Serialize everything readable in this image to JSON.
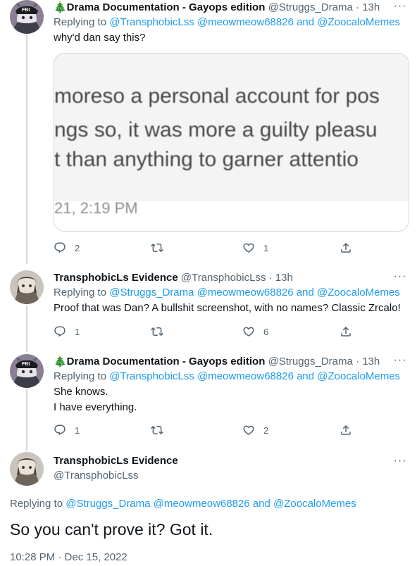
{
  "tweets": [
    {
      "name": "🎄Drama Documentation - Gayops edition",
      "handle": "@Struggs_Drama",
      "time": "13h",
      "replying_prefix": "Replying to",
      "replying_to": "@TransphobicLss @meowmeow68826",
      "replying_and": "and",
      "replying_last": "@ZoocaloMemes",
      "text_lines": [
        "why'd dan say this?"
      ],
      "image": {
        "lines": [
          "moreso a personal account for pos",
          "ngs so, it was more a guilty pleasu",
          "t than anything to garner attentio"
        ],
        "time": "21, 2:19 PM"
      },
      "counts": {
        "reply": "2",
        "retweet": "",
        "like": "1"
      }
    },
    {
      "name": "TransphobicLs Evidence",
      "handle": "@TransphobicLss",
      "time": "13h",
      "replying_prefix": "Replying to",
      "replying_to": "@Struggs_Drama @meowmeow68826",
      "replying_and": "and",
      "replying_last": "@ZoocaloMemes",
      "text_lines": [
        "Proof that was Dan? A bullshit screenshot, with no names? Classic Zrcalo!"
      ],
      "counts": {
        "reply": "1",
        "retweet": "",
        "like": "6"
      }
    },
    {
      "name": "🎄Drama Documentation - Gayops edition",
      "handle": "@Struggs_Drama",
      "time": "13h",
      "replying_prefix": "Replying to",
      "replying_to": "@TransphobicLss @meowmeow68826",
      "replying_and": "and",
      "replying_last": "@ZoocaloMemes",
      "text_lines": [
        "She knows.",
        "I have everything."
      ],
      "counts": {
        "reply": "1",
        "retweet": "",
        "like": "2"
      }
    }
  ],
  "focus": {
    "name": "TransphobicLs Evidence",
    "handle": "@TransphobicLss",
    "replying_prefix": "Replying to",
    "replying_to": "@Struggs_Drama @meowmeow68826",
    "replying_and": "and",
    "replying_last": "@ZoocaloMemes",
    "text": "So you can't prove it? Got it.",
    "meta": "10:28 PM · Dec 15, 2022"
  },
  "icons": {
    "more": "more-icon",
    "reply": "reply-icon",
    "retweet": "retweet-icon",
    "like": "like-icon",
    "share": "share-icon"
  },
  "colors": {
    "accent": "#1d9bf0",
    "muted": "#536471",
    "text": "#0f1419"
  }
}
